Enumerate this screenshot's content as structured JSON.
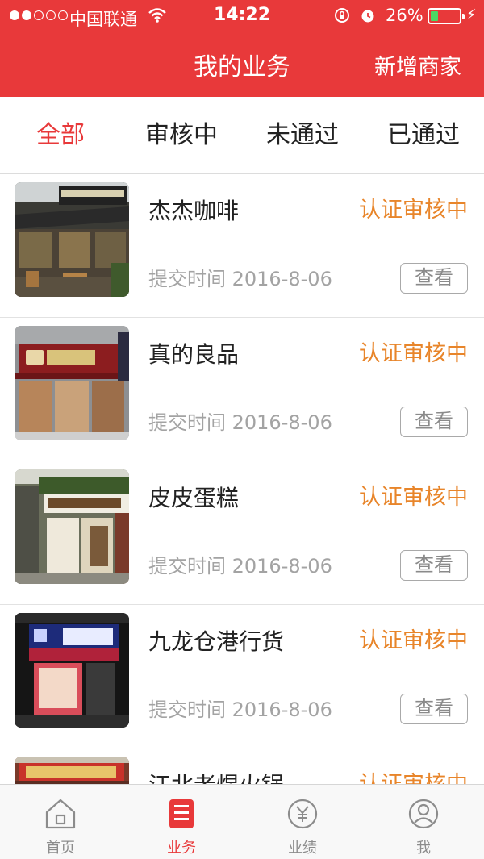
{
  "status_bar": {
    "carrier": "中国联通",
    "time": "14:22",
    "battery_percent": "26%",
    "battery_level": 0.26
  },
  "nav": {
    "title": "我的业务",
    "right_action": "新增商家",
    "bg_color": "#e8393a"
  },
  "tabs": [
    {
      "label": "全部",
      "active": true
    },
    {
      "label": "审核中",
      "active": false
    },
    {
      "label": "未通过",
      "active": false
    },
    {
      "label": "已通过",
      "active": false
    }
  ],
  "list": {
    "items": [
      {
        "name": "杰杰咖啡",
        "status": "认证审核中",
        "submit_time": "提交时间 2016-8-06",
        "action": "查看",
        "thumb_icon": "coffee-shop-photo"
      },
      {
        "name": "真的良品",
        "status": "认证审核中",
        "submit_time": "提交时间 2016-8-06",
        "action": "查看",
        "thumb_icon": "grocery-store-photo"
      },
      {
        "name": "皮皮蛋糕",
        "status": "认证审核中",
        "submit_time": "提交时间 2016-8-06",
        "action": "查看",
        "thumb_icon": "bakery-photo"
      },
      {
        "name": "九龙仓港行货",
        "status": "认证审核中",
        "submit_time": "提交时间 2016-8-06",
        "action": "查看",
        "thumb_icon": "retail-store-photo"
      },
      {
        "name": "江北老煜火锅",
        "status": "认证审核中",
        "submit_time": "",
        "action": "",
        "thumb_icon": "restaurant-photo"
      }
    ],
    "status_color": "#e8852a"
  },
  "tabbar": [
    {
      "label": "首页",
      "icon": "home-icon",
      "active": false
    },
    {
      "label": "业务",
      "icon": "business-list-icon",
      "active": true
    },
    {
      "label": "业绩",
      "icon": "yuan-icon",
      "active": false
    },
    {
      "label": "我",
      "icon": "user-icon",
      "active": false
    }
  ]
}
